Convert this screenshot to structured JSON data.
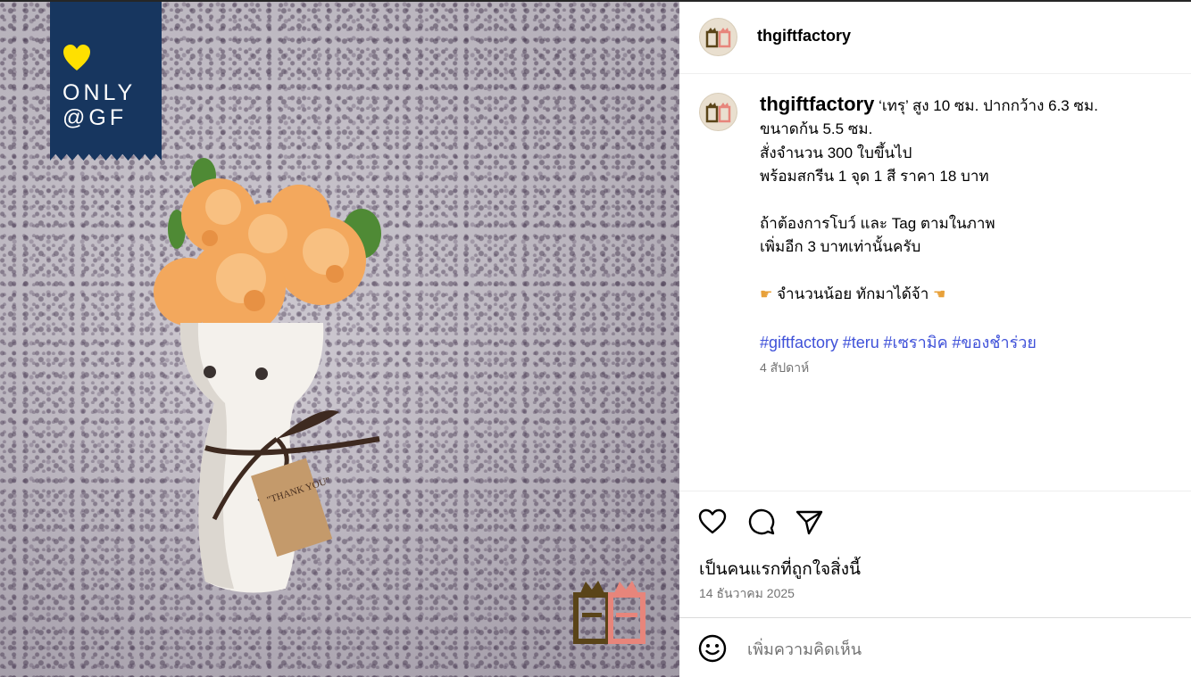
{
  "post": {
    "username": "thgiftfactory",
    "ribbon": {
      "line1": "ONLY",
      "line2": "@GF"
    },
    "caption_lines": [
      "‘เทรุ’ สูง 10 ซม. ปากกว้าง 6.3 ซม.",
      "ขนาดก้น 5.5 ซม.",
      "สั่งจำนวน 300 ใบขึ้นไป",
      "พร้อมสกรีน 1 จุด 1 สี ราคา 18 บาท",
      "",
      "ถ้าต้องการโบว์ และ Tag ตามในภาพ",
      "เพิ่มอีก 3 บาทเท่านั้นครับ",
      "",
      "จำนวนน้อย ทักมาได้จ้า"
    ],
    "hashtags": [
      "#giftfactory",
      "#teru",
      "#เซรามิค",
      "#ของชำร่วย"
    ],
    "caption_time": "4 สัปดาห์",
    "likes_text": "เป็นคนแรกที่ถูกใจสิ่งนี้",
    "date": "14 ธันวาคม 2025",
    "comment_placeholder": "เพิ่มความคิดเห็น",
    "icons": {
      "like": "heart-icon",
      "comment": "speech-bubble-icon",
      "share": "paper-plane-icon",
      "emoji": "smiley-icon"
    },
    "colors": {
      "hashtag": "#3f51d9",
      "ribbon": "#17365f",
      "heart_yellow": "#ffe000",
      "secondary_text": "#737373"
    }
  }
}
